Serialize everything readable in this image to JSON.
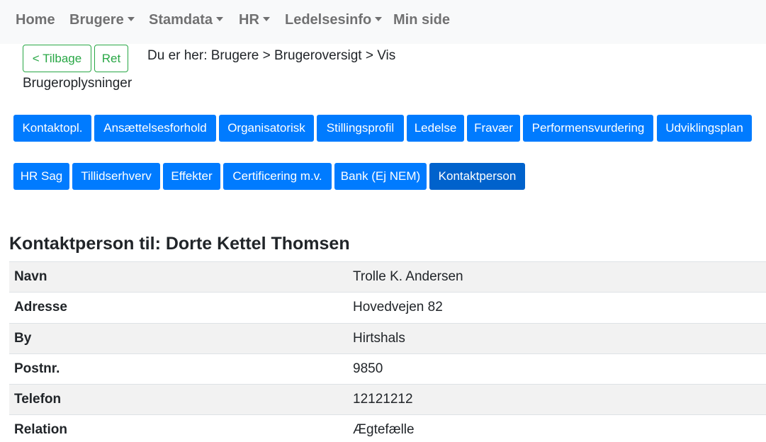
{
  "nav": {
    "home": "Home",
    "brugere": "Brugere",
    "stamdata": "Stamdata",
    "hr": "HR",
    "ledelsesinfo": "Ledelsesinfo",
    "min_side": "Min side"
  },
  "actions": {
    "back": "< Tilbage",
    "edit": "Ret"
  },
  "breadcrumb": {
    "line1": "Du er her: Brugere > Brugeroversigt > Vis",
    "line2": "Brugeroplysninger"
  },
  "tabs": [
    {
      "label": "Kontaktopl."
    },
    {
      "label": "Ansættelsesforhold"
    },
    {
      "label": "Organisatorisk"
    },
    {
      "label": "Stillingsprofil"
    },
    {
      "label": "Ledelse"
    },
    {
      "label": "Fravær"
    },
    {
      "label": "Performensvurdering"
    },
    {
      "label": "Udviklingsplan"
    },
    {
      "label": "HR Sag"
    },
    {
      "label": "Tillidserhverv"
    },
    {
      "label": "Effekter"
    },
    {
      "label": "Certificering m.v."
    },
    {
      "label": "Bank (Ej NEM)"
    },
    {
      "label": "Kontaktperson",
      "active": true
    }
  ],
  "section": {
    "title": "Kontaktperson til: Dorte Kettel Thomsen"
  },
  "rows": [
    {
      "label": "Navn",
      "value": "Trolle K. Andersen"
    },
    {
      "label": "Adresse",
      "value": "Hovedvejen 82"
    },
    {
      "label": "By",
      "value": "Hirtshals"
    },
    {
      "label": "Postnr.",
      "value": "9850"
    },
    {
      "label": "Telefon",
      "value": "12121212"
    },
    {
      "label": "Relation",
      "value": "Ægtefælle"
    }
  ],
  "colors": {
    "primary": "#007bff",
    "primary_active": "#0062cc",
    "success": "#28a745",
    "navbar_bg": "#f8f9fa",
    "stripe": "#f2f2f2"
  }
}
